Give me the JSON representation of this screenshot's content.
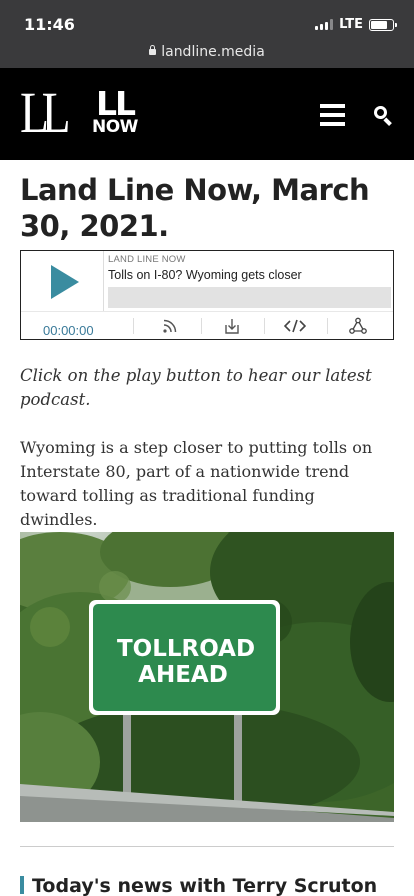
{
  "status_bar": {
    "time": "11:46",
    "network": "LTE",
    "battery_level": 0.75
  },
  "browser": {
    "url": "landline.media"
  },
  "header": {
    "logo_main": "LL",
    "logo_sub_top": "LL",
    "logo_sub_bottom": "NOW"
  },
  "article": {
    "title": "Land Line Now, March 30, 2021.",
    "intro": "Click on the play button to hear our latest podcast.",
    "body": "Wyoming is a step closer to putting tolls on Interstate 80, part of a nationwide trend toward tolling as traditional funding dwindles.",
    "image_sign_line1": "TOLLROAD",
    "image_sign_line2": "AHEAD"
  },
  "player": {
    "show_name": "LAND LINE NOW",
    "episode_title": "Tolls on I-80? Wyoming gets closer",
    "time": "00:00:00",
    "progress": 0,
    "controls": [
      "rss-icon",
      "download-icon",
      "embed-icon",
      "share-icon"
    ]
  },
  "next_section": {
    "heading": "Today's news with Terry Scruton"
  },
  "colors": {
    "accent": "#3a8ca0",
    "header_bg": "#000000",
    "chrome_bg": "#3a3a3c"
  }
}
